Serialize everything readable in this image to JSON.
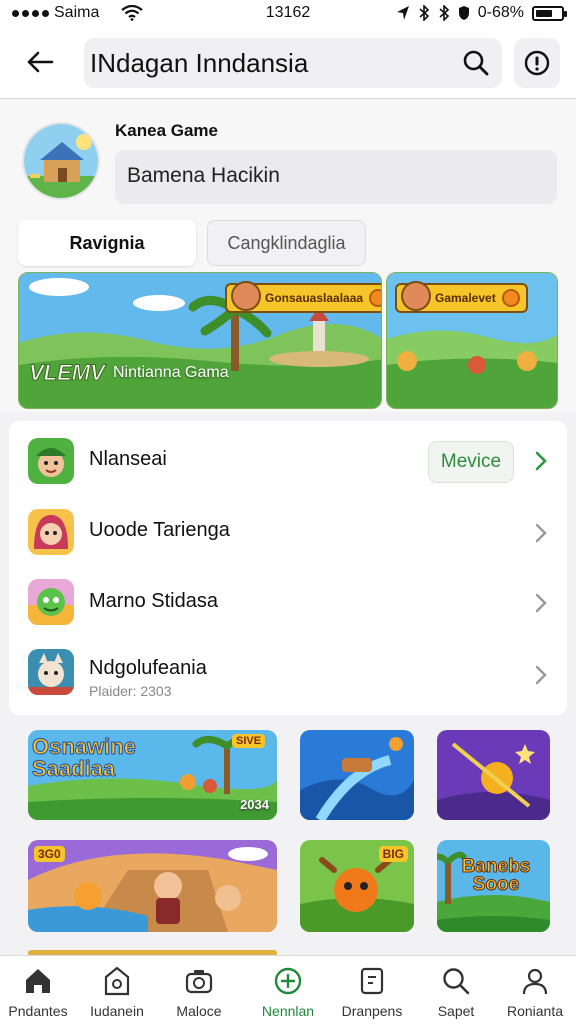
{
  "status_bar": {
    "carrier": "Saima",
    "time": "13162",
    "battery": "0-68%",
    "battery_level": 0.68
  },
  "header": {
    "search_query": "INdagan Inndansia"
  },
  "profile": {
    "game_name": "Kanea Game",
    "name_field": "Bamena Hacikin",
    "tabs": [
      "Ravignia",
      "Cangklindaglia"
    ]
  },
  "banners": {
    "main": {
      "chip": "Gonsauaslaalaaa",
      "logo": "VLEMV",
      "caption": "Nintianna Gama"
    },
    "side": {
      "chip": "Gamalevet"
    }
  },
  "list": {
    "items": [
      {
        "title": "Nlanseai",
        "action": "Mevice",
        "icon": "farmer-icon"
      },
      {
        "title": "Uoode Tarienga",
        "icon": "girl-icon"
      },
      {
        "title": "Marno Stidasa",
        "icon": "green-creature-icon"
      },
      {
        "title": "Ndgolufeania",
        "subtitle": "Plaider: 2303",
        "icon": "cat-icon"
      }
    ]
  },
  "grid": {
    "tiles": [
      {
        "title": "Osnawine Saadiaa",
        "badge": "2034",
        "chip": "SIVE"
      },
      {
        "title": "",
        "badge": ""
      },
      {
        "title": "",
        "badge": ""
      },
      {
        "title": "",
        "badge": "3G0"
      },
      {
        "title": "",
        "badge": "BIG"
      },
      {
        "title": "Banebs Sooe",
        "badge": ""
      }
    ]
  },
  "nav": {
    "items": [
      {
        "label": "Pndantes",
        "icon": "home-icon"
      },
      {
        "label": "Iudanein",
        "icon": "tablet-icon"
      },
      {
        "label": "Maloce",
        "icon": "camera-icon"
      },
      {
        "label": "Nennlan",
        "icon": "add-icon"
      },
      {
        "label": "Dranpens",
        "icon": "doc-icon"
      },
      {
        "label": "Sapet",
        "icon": "search-icon"
      },
      {
        "label": "Ronianta",
        "icon": "profile-icon"
      }
    ]
  },
  "colors": {
    "accent_green": "#1e8a3a",
    "banner_chip": "#f5c52a"
  }
}
